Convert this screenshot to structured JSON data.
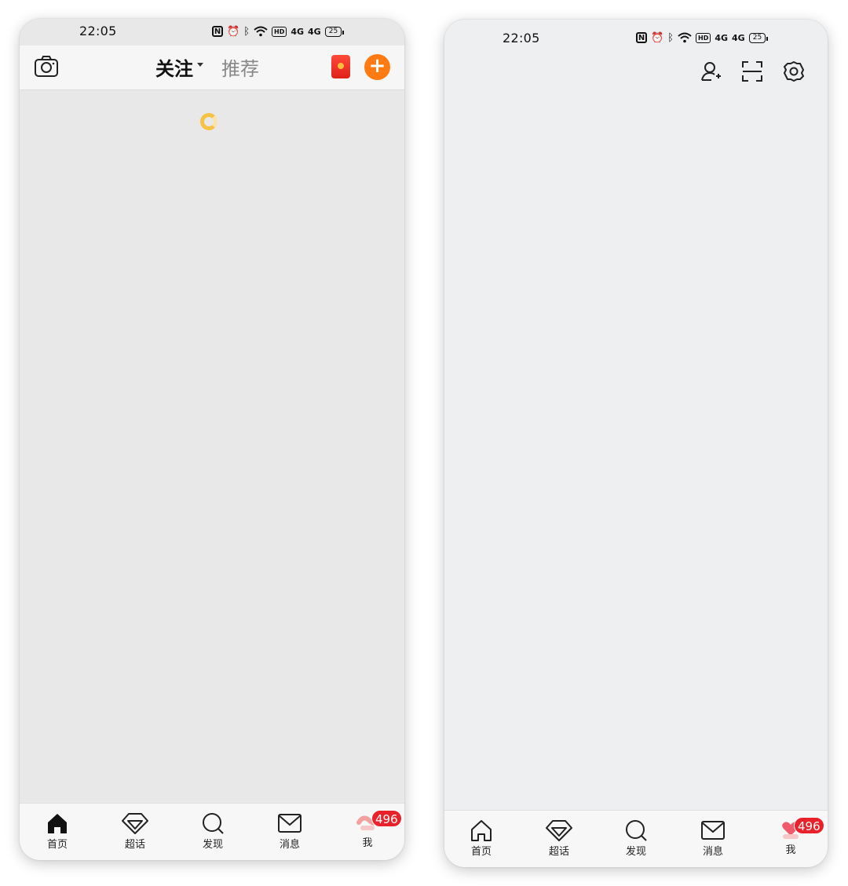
{
  "left": {
    "status": {
      "time": "22:05",
      "nfc": "N",
      "hd": "HD",
      "sig1": "4G",
      "sig2": "4G",
      "battery": "25"
    },
    "header": {
      "tab_follow": "关注",
      "tab_recommend": "推荐"
    },
    "nav": [
      {
        "label": "首页"
      },
      {
        "label": "超话"
      },
      {
        "label": "发现"
      },
      {
        "label": "消息"
      },
      {
        "label": "我",
        "badge": "496"
      }
    ]
  },
  "right": {
    "status": {
      "time": "22:05",
      "nfc": "N",
      "hd": "HD",
      "sig1": "4G",
      "sig2": "4G",
      "battery": "25"
    },
    "nav": [
      {
        "label": "首页"
      },
      {
        "label": "超话"
      },
      {
        "label": "发现"
      },
      {
        "label": "消息"
      },
      {
        "label": "我",
        "badge": "496"
      }
    ]
  },
  "colors": {
    "accent": "#ff7a12",
    "tab_underline": "#f5a623",
    "badge": "#e8212a"
  }
}
